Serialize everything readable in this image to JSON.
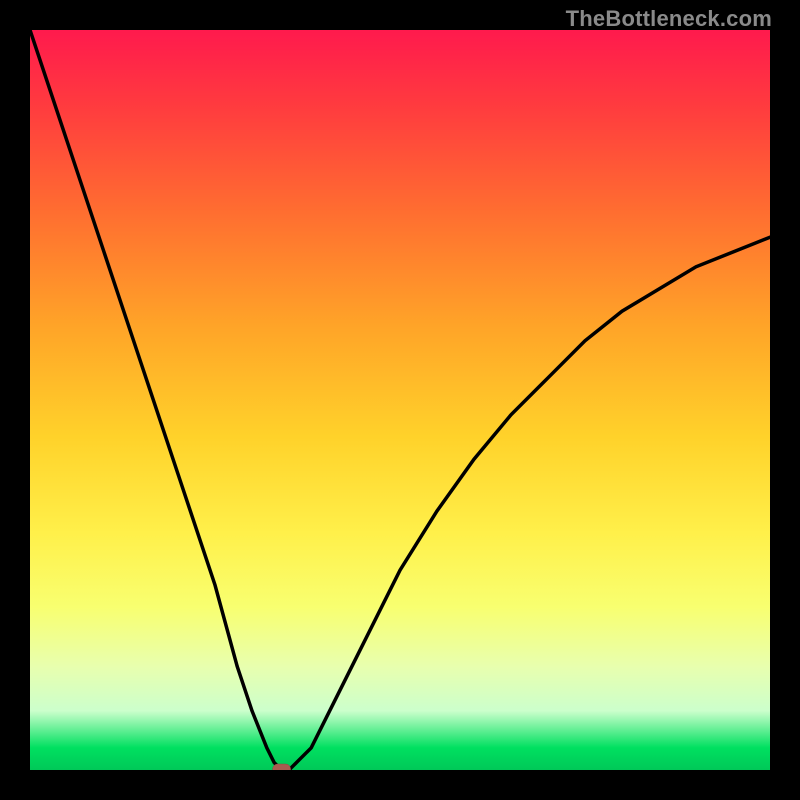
{
  "attribution": "TheBottleneck.com",
  "chart_data": {
    "type": "line",
    "title": "",
    "xlabel": "",
    "ylabel": "",
    "xlim": [
      0,
      100
    ],
    "ylim": [
      0,
      100
    ],
    "grid": false,
    "legend": false,
    "series": [
      {
        "name": "bottleneck-curve",
        "x": [
          0,
          5,
          10,
          15,
          20,
          25,
          28,
          30,
          32,
          33,
          34,
          35,
          36,
          38,
          40,
          45,
          50,
          55,
          60,
          65,
          70,
          75,
          80,
          85,
          90,
          95,
          100
        ],
        "y": [
          100,
          85,
          70,
          55,
          40,
          25,
          14,
          8,
          3,
          1,
          0,
          0,
          1,
          3,
          7,
          17,
          27,
          35,
          42,
          48,
          53,
          58,
          62,
          65,
          68,
          70,
          72
        ]
      }
    ],
    "marker": {
      "x": 34,
      "y": 0
    },
    "background_gradient": {
      "stops": [
        {
          "pos": 0.0,
          "color": "#ff1a4d"
        },
        {
          "pos": 0.25,
          "color": "#ff6f30"
        },
        {
          "pos": 0.55,
          "color": "#ffd22a"
        },
        {
          "pos": 0.78,
          "color": "#f8ff70"
        },
        {
          "pos": 0.92,
          "color": "#ccffcc"
        },
        {
          "pos": 1.0,
          "color": "#00c858"
        }
      ]
    }
  }
}
